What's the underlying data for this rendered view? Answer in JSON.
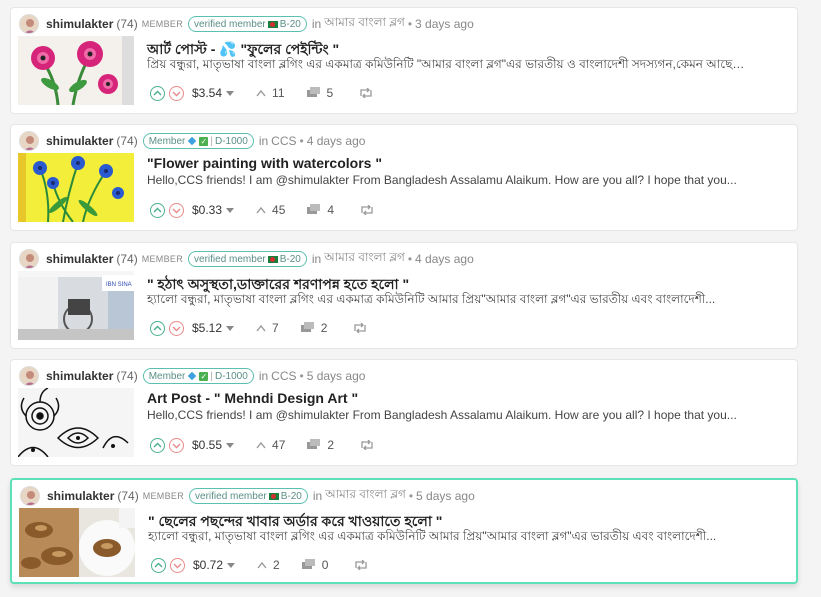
{
  "posts": [
    {
      "author": "shimulakter",
      "reputation": "(74)",
      "member_label": "MEMBER",
      "badge_text": "verified member",
      "badge_code": "B-20",
      "in_label": "in",
      "community": "আমার বাংলা ব্লগ",
      "time": "3 days ago",
      "title": "আর্ট পোস্ট - 💦 \"ফুলের পেইন্টিং \"",
      "excerpt": "প্রিয় বন্ধুরা, মাতৃভাষা বাংলা ব্লগিং এর একমাত্র কমিউনিটি \"আমার বাংলা ব্লগ\"এর ভারতীয় ও বাংলাদেশী সদস্যগন,কেমন আছেন...",
      "payout": "$3.54",
      "votes": "11",
      "comments": "5",
      "badge_type": "verified"
    },
    {
      "author": "shimulakter",
      "reputation": "(74)",
      "member_label": "",
      "badge_text": "Member",
      "badge_code": "D-1000",
      "in_label": "in",
      "community": "CCS",
      "time": "4 days ago",
      "title": "\"Flower painting with watercolors \"",
      "excerpt": "Hello,CCS friends! I am @shimulakter From Bangladesh Assalamu Alaikum. How are you all? I hope that you...",
      "payout": "$0.33",
      "votes": "45",
      "comments": "4",
      "badge_type": "member"
    },
    {
      "author": "shimulakter",
      "reputation": "(74)",
      "member_label": "MEMBER",
      "badge_text": "verified member",
      "badge_code": "B-20",
      "in_label": "in",
      "community": "আমার বাংলা ব্লগ",
      "time": "4 days ago",
      "title": "\" হঠাৎ অসুস্থতা,ডাক্তারের শরণাপন্ন হতে হলো \"",
      "excerpt": "হ্যালো বন্ধুরা, মাতৃভাষা বাংলা ব্লগিং এর একমাত্র কমিউনিটি আমার প্রিয়\"আমার বাংলা ব্লগ\"এর ভারতীয় এবং বাংলাদেশী...",
      "payout": "$5.12",
      "votes": "7",
      "comments": "2",
      "badge_type": "verified"
    },
    {
      "author": "shimulakter",
      "reputation": "(74)",
      "member_label": "",
      "badge_text": "Member",
      "badge_code": "D-1000",
      "in_label": "in",
      "community": "CCS",
      "time": "5 days ago",
      "title": "Art Post - \" Mehndi Design Art \"",
      "excerpt": "Hello,CCS friends! I am @shimulakter From Bangladesh Assalamu Alaikum. How are you all? I hope that you...",
      "payout": "$0.55",
      "votes": "47",
      "comments": "2",
      "badge_type": "member"
    },
    {
      "author": "shimulakter",
      "reputation": "(74)",
      "member_label": "MEMBER",
      "badge_text": "verified member",
      "badge_code": "B-20",
      "in_label": "in",
      "community": "আমার বাংলা ব্লগ",
      "time": "5 days ago",
      "title": "\" ছেলের পছন্দের খাবার অর্ডার করে খাওয়াতে হলো \"",
      "excerpt": "হ্যালো বন্ধুরা, মাতৃভাষা বাংলা ব্লগিং এর একমাত্র কমিউনিটি আমার প্রিয়\"আমার বাংলা ব্লগ\"এর ভারতীয় এবং বাংলাদেশী...",
      "payout": "$0.72",
      "votes": "2",
      "comments": "0",
      "badge_type": "verified"
    }
  ],
  "icons": {
    "upvote": "upvote-icon",
    "downvote": "downvote-icon",
    "votes": "upvote-count-icon",
    "comments": "comments-icon",
    "reblog": "reblog-icon"
  },
  "colors": {
    "accent": "#5de1b8",
    "upvote": "#4ab08a",
    "downvote": "#e88a8a",
    "badge_border": "#5bc0b0"
  }
}
